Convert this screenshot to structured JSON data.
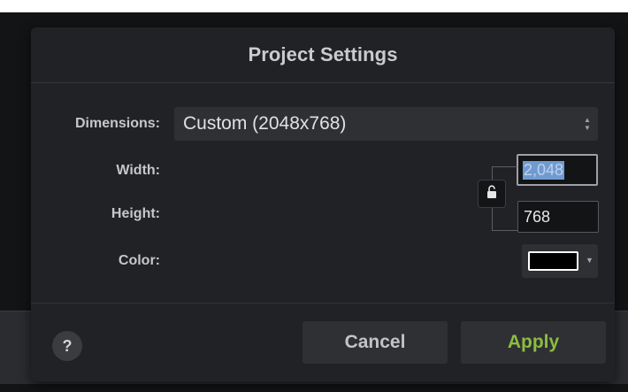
{
  "dialog": {
    "title": "Project Settings",
    "dimensions_label": "Dimensions:",
    "dimensions_value": "Custom (2048x768)",
    "width_label": "Width:",
    "width_value": "2,048",
    "height_label": "Height:",
    "height_value": "768",
    "color_label": "Color:",
    "color_value": "#000000",
    "lock_icon": "unlocked-padlock-icon",
    "help_label": "?",
    "cancel_label": "Cancel",
    "apply_label": "Apply"
  },
  "colors": {
    "dialog_bg": "#202225",
    "accent_apply": "#8cbd3f",
    "selection": "#6f9bd0"
  }
}
